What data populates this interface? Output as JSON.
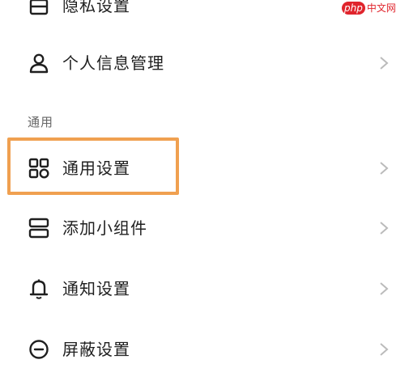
{
  "watermark": {
    "logo": "php",
    "text": "中文网"
  },
  "items_top": [
    {
      "label": "隐私设置",
      "icon": "privacy-icon"
    },
    {
      "label": "个人信息管理",
      "icon": "user-icon"
    }
  ],
  "section": {
    "title": "通用"
  },
  "items": [
    {
      "label": "通用设置",
      "icon": "grid-icon"
    },
    {
      "label": "添加小组件",
      "icon": "widget-icon"
    },
    {
      "label": "通知设置",
      "icon": "bell-icon"
    },
    {
      "label": "屏蔽设置",
      "icon": "block-icon"
    }
  ],
  "colors": {
    "highlight": "#f0a050",
    "chevron": "#bbbbbb",
    "watermark": "#e0242c"
  }
}
